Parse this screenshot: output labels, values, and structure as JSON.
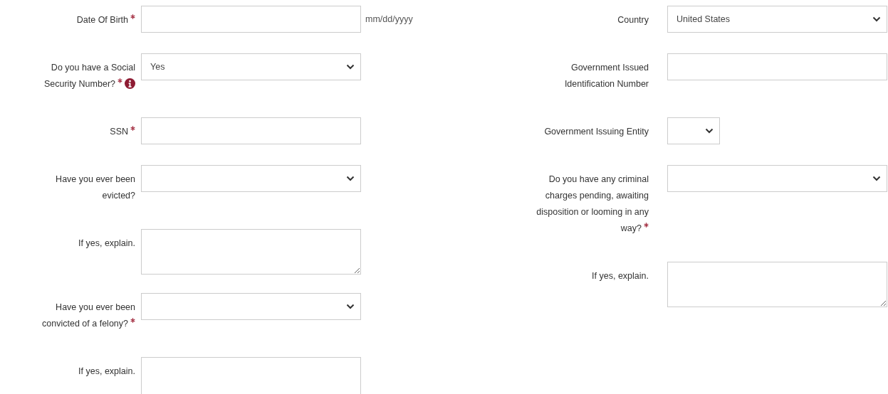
{
  "left_fields": [
    {
      "kind": "text",
      "label": "Date Of Birth",
      "required": true,
      "hint": "mm/dd/yyyy"
    },
    {
      "kind": "select",
      "label": "Do you have a Social Security Number?",
      "required": true,
      "info": true,
      "value": "Yes"
    },
    {
      "kind": "text",
      "label": "SSN",
      "required": true
    },
    {
      "kind": "select",
      "label": "Have you ever been evicted?",
      "required": false
    },
    {
      "kind": "textarea",
      "label": "If yes, explain.",
      "required": false
    },
    {
      "kind": "select",
      "label": "Have you ever been convicted of a felony?",
      "required": true
    },
    {
      "kind": "textarea",
      "label": "If yes, explain.",
      "required": false
    }
  ],
  "right_fields": [
    {
      "kind": "select",
      "label": "Country",
      "required": false,
      "value": "United States"
    },
    {
      "kind": "text",
      "label": "Government Issued Identification Number",
      "required": false
    },
    {
      "kind": "smallselect",
      "label": "Government Issuing Entity",
      "required": false
    },
    {
      "kind": "select",
      "label": "Do you have any criminal charges pending, awaiting disposition or looming in any way?",
      "required": true
    },
    {
      "kind": "textarea",
      "label": "If yes, explain.",
      "required": false
    }
  ]
}
